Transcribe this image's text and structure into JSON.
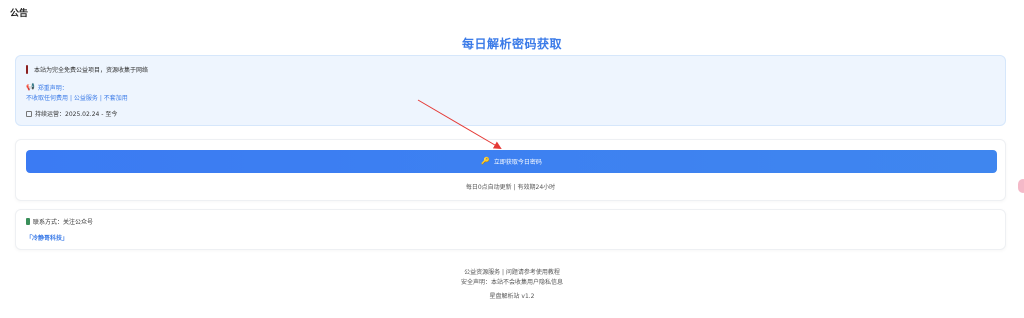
{
  "header": {
    "title": "公告"
  },
  "page": {
    "heading": "每日解析密码获取"
  },
  "notice": {
    "intro": "本站为完全免费公益项目，资源收集于网络",
    "disclaimer_label": "郑重声明：",
    "links": [
      "不收取任何费用",
      "公益服务",
      "不套加用"
    ],
    "separator": "|",
    "operating_period": "持续运营：2025.02.24 - 至今"
  },
  "action": {
    "button_label": "立即获取今日密码",
    "subtext": "每日0点自动更新 | 有效期24小时"
  },
  "contact": {
    "label": "联系方式：关注公众号",
    "account": "「冷静哥科技」"
  },
  "footer": {
    "line1": "公益资源服务 | 问题请参考使用教程",
    "line2": "安全声明：本站不会收集用户隐私信息",
    "version": "星盘解析站 v1.2"
  },
  "colors": {
    "accent": "#3b7be8",
    "button": "#3b7bf3",
    "notice_bg": "#eef5fe",
    "annotation_arrow": "#e53935"
  },
  "icons": {
    "intro": "bar-mark-icon",
    "disclaimer": "megaphone-icon",
    "period": "calendar-icon",
    "button": "key-icon",
    "contact": "phone-icon"
  }
}
